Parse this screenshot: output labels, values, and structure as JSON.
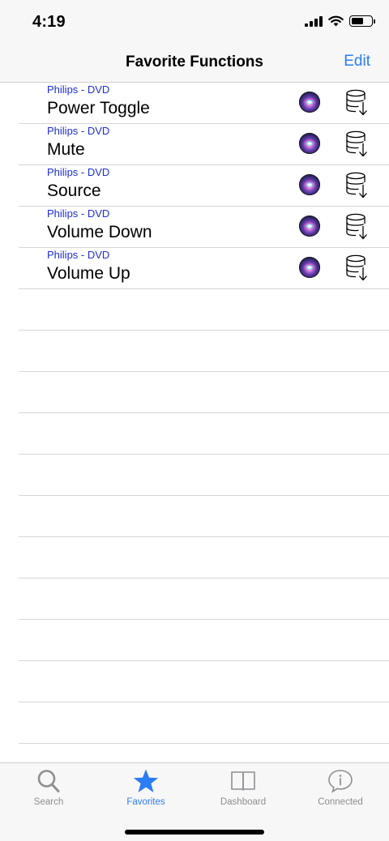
{
  "status_bar": {
    "time": "4:19",
    "battery_level": 0.6
  },
  "nav": {
    "title": "Favorite Functions",
    "edit_label": "Edit"
  },
  "colors": {
    "accent": "#2c7cf6",
    "subtitle": "#1d2fd6",
    "tab_inactive": "#8e8e93"
  },
  "favorites": [
    {
      "device": "Philips - DVD",
      "name": "Power Toggle",
      "siri_icon": "siri-icon",
      "action_icon": "database-download-icon"
    },
    {
      "device": "Philips - DVD",
      "name": "Mute",
      "siri_icon": "siri-icon",
      "action_icon": "database-download-icon"
    },
    {
      "device": "Philips - DVD",
      "name": "Source",
      "siri_icon": "siri-icon",
      "action_icon": "database-download-icon"
    },
    {
      "device": "Philips - DVD",
      "name": "Volume Down",
      "siri_icon": "siri-icon",
      "action_icon": "database-download-icon"
    },
    {
      "device": "Philips - DVD",
      "name": "Volume Up",
      "siri_icon": "siri-icon",
      "action_icon": "database-download-icon"
    }
  ],
  "tabs": [
    {
      "label": "Search",
      "icon": "search-icon",
      "active": false
    },
    {
      "label": "Favorites",
      "icon": "star-icon",
      "active": true
    },
    {
      "label": "Dashboard",
      "icon": "book-icon",
      "active": false
    },
    {
      "label": "Connected",
      "icon": "info-bubble-icon",
      "active": false
    }
  ]
}
